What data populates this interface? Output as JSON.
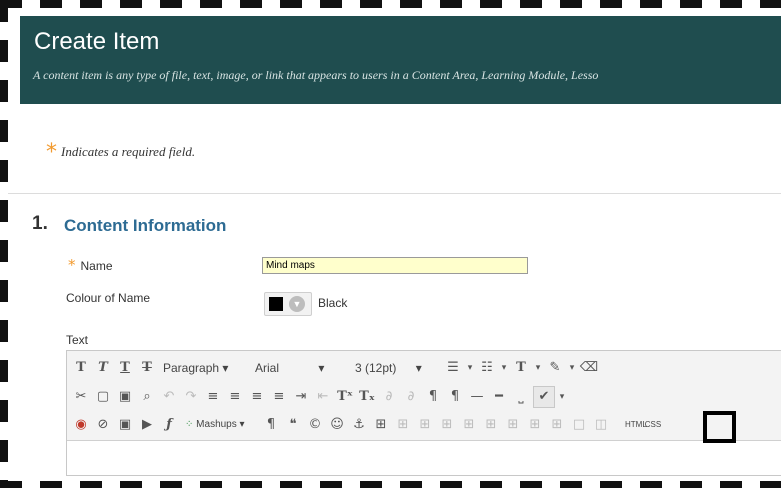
{
  "header": {
    "title": "Create Item",
    "subtitle": "A content item is any type of file, text, image, or link that appears to users in a Content Area, Learning Module, Lesso"
  },
  "required_note": {
    "star": "*",
    "text": "Indicates a required field."
  },
  "section": {
    "number": "1.",
    "title": "Content Information",
    "fields": {
      "name_label": "Name",
      "name_star": "*",
      "name_value": "Mind maps",
      "colour_label": "Colour of Name",
      "colour_value": "Black",
      "colour_hex": "#000000",
      "text_label": "Text"
    }
  },
  "toolbar": {
    "row1": {
      "bold": "T",
      "italic": "T",
      "underline": "T",
      "strike": "T",
      "paragraph": "Paragraph",
      "font": "Arial",
      "size": "3 (12pt)",
      "arrow": "▾"
    },
    "row3": {
      "mashups": "Mashups",
      "html": "HTML",
      "css": "CSS"
    }
  },
  "colors": {
    "header_bg": "#1f4d4f",
    "accent_star": "#f29a2e",
    "section_title": "#2d6b93",
    "input_bg": "#ffffcc"
  }
}
